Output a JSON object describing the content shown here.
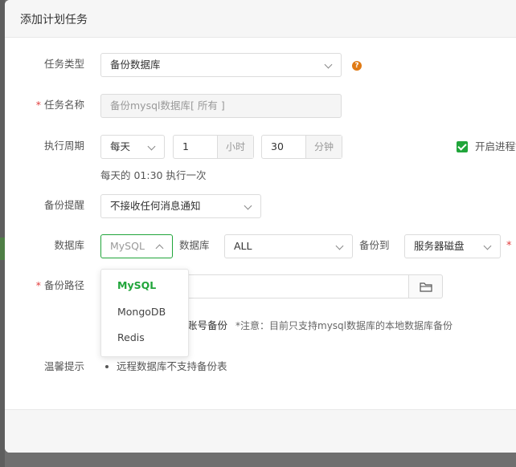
{
  "dialog": {
    "title": "添加计划任务"
  },
  "form": {
    "task_type": {
      "label": "任务类型",
      "value": "备份数据库"
    },
    "task_name": {
      "label": "任务名称",
      "placeholder": "备份mysql数据库[ 所有 ]"
    },
    "period": {
      "label": "执行周期",
      "cycle": "每天",
      "hour": "1",
      "hour_unit": "小时",
      "minute": "30",
      "minute_unit": "分钟",
      "hint": "每天的 01:30 执行一次",
      "process_lock_label": "开启进程锁"
    },
    "notify": {
      "label": "备份提醒",
      "value": "不接收任何消息通知"
    },
    "database": {
      "label": "数据库",
      "type_value": "MySQL",
      "db_label": "数据库",
      "db_value": "ALL",
      "backup_to_label": "备份到",
      "backup_to_value": "服务器磁盘",
      "options": [
        "MySQL",
        "MongoDB",
        "Redis"
      ]
    },
    "path": {
      "label": "备份路径"
    },
    "account_backup": {
      "label": "账号备份",
      "note": "*注意：目前只支持mysql数据库的本地数据库备份"
    },
    "tips": {
      "label": "温馨提示",
      "items": [
        "远程数据库不支持备份表"
      ]
    }
  },
  "colors": {
    "accent": "#20a53a",
    "required": "#e23d3d",
    "help": "#e07a14"
  }
}
